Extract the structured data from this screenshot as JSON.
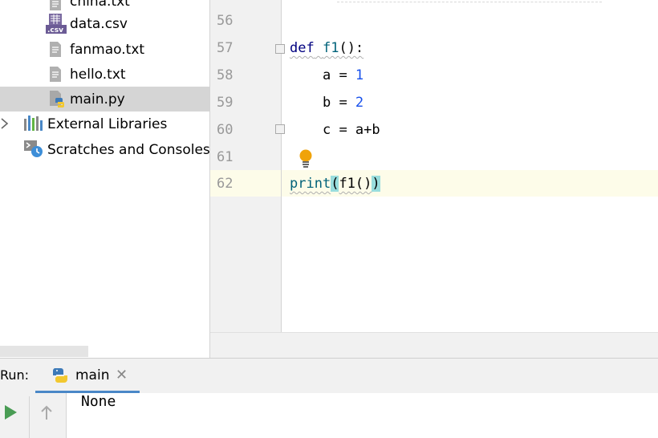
{
  "project_tree": {
    "items": [
      {
        "label": "china.txt",
        "icon": "text-file-icon"
      },
      {
        "label": "data.csv",
        "icon": "csv-file-icon",
        "badge": ".csv"
      },
      {
        "label": "fanmao.txt",
        "icon": "text-file-icon"
      },
      {
        "label": "hello.txt",
        "icon": "text-file-icon"
      },
      {
        "label": "main.py",
        "icon": "python-file-icon",
        "selected": true
      },
      {
        "label": "External Libraries",
        "icon": "libraries-icon"
      },
      {
        "label": "Scratches and Consoles",
        "icon": "scratches-icon"
      }
    ]
  },
  "editor": {
    "line_numbers": [
      "56",
      "57",
      "58",
      "59",
      "60",
      "61",
      "62"
    ],
    "lines": {
      "l57": {
        "kw": "def",
        "name": "f1",
        "rest": "():"
      },
      "l58": {
        "var": "a",
        "op": " = ",
        "val": "1"
      },
      "l59": {
        "var": "b",
        "op": " = ",
        "val": "2"
      },
      "l60": {
        "var": "c",
        "op": " = ",
        "val": "a+b"
      },
      "l62": {
        "fn": "print",
        "open": "(",
        "inner": "f1()",
        "close": ")"
      }
    },
    "current_line": "62",
    "colors": {
      "keyword": "#000080",
      "function": "#00627a",
      "number": "#1750eb",
      "brace_highlight": "#99dddd",
      "current_line": "#fdfce9",
      "bulb": "#f0a30a"
    }
  },
  "run_panel": {
    "label": "Run:",
    "tab_label": "main",
    "console_output": "None"
  }
}
